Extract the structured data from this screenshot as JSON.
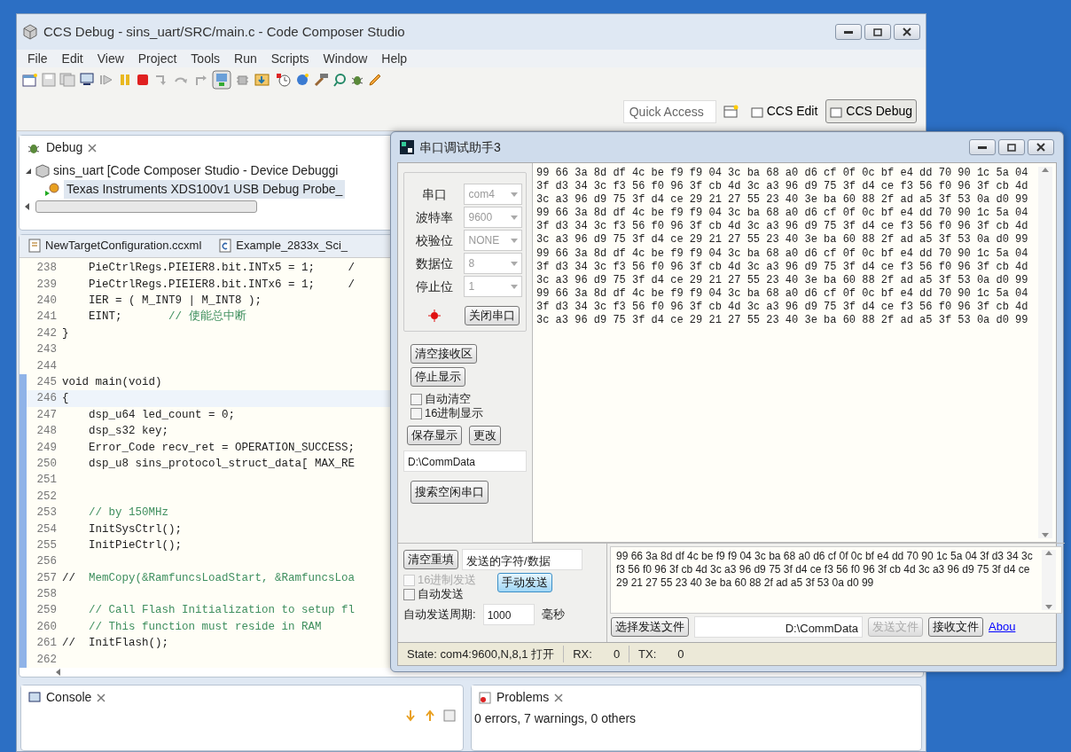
{
  "ccs_window": {
    "title": "CCS Debug - sins_uart/SRC/main.c - Code Composer Studio"
  },
  "menu": [
    "File",
    "Edit",
    "View",
    "Project",
    "Tools",
    "Run",
    "Scripts",
    "Window",
    "Help"
  ],
  "quick_access": {
    "placeholder": "Quick Access"
  },
  "perspectives": [
    {
      "label": "CCS Edit",
      "selected": false
    },
    {
      "label": "CCS Debug",
      "selected": true
    }
  ],
  "debug_view": {
    "tab": "Debug",
    "tree": [
      {
        "label": "sins_uart [Code Composer Studio - Device Debuggi",
        "expanded": true,
        "selected": false,
        "children": [
          {
            "label": "Texas Instruments XDS100v1 USB Debug Probe_",
            "selected": true
          }
        ]
      }
    ]
  },
  "editor": {
    "tabs": [
      {
        "label": "NewTargetConfiguration.ccxml",
        "kind": "xml"
      },
      {
        "label": "Example_2833x_Sci_",
        "kind": "c"
      }
    ],
    "lines": [
      {
        "number": "238",
        "code": "    PieCtrlRegs.PIEIER8.bit.INTx5 = 1;     /",
        "changed": false,
        "current": false
      },
      {
        "number": "239",
        "code": "    PieCtrlRegs.PIEIER8.bit.INTx6 = 1;     /",
        "changed": false,
        "current": false
      },
      {
        "number": "240",
        "code": "    IER = ( M_INT9 | M_INT8 );",
        "changed": false,
        "current": false
      },
      {
        "number": "241",
        "code": "    EINT;       ",
        "comment": "// 使能总中断",
        "changed": false,
        "current": false
      },
      {
        "number": "242",
        "code": "}",
        "changed": false,
        "current": false
      },
      {
        "number": "243",
        "changed": false,
        "current": false
      },
      {
        "number": "244",
        "changed": false,
        "current": false
      },
      {
        "number": "245",
        "code": "void main(void)",
        "changed": true,
        "current": false
      },
      {
        "number": "246",
        "code": "{",
        "changed": true,
        "current": true
      },
      {
        "number": "247",
        "code": "    dsp_u64 led_count = 0;",
        "changed": true,
        "current": false
      },
      {
        "number": "248",
        "code": "    dsp_s32 key;",
        "changed": true,
        "current": false
      },
      {
        "number": "249",
        "code": "    Error_Code recv_ret = OPERATION_SUCCESS;",
        "changed": true,
        "current": false
      },
      {
        "number": "250",
        "code": "    dsp_u8 sins_protocol_struct_data[ MAX_RE",
        "changed": true,
        "current": false
      },
      {
        "number": "251",
        "changed": true,
        "current": false
      },
      {
        "number": "252",
        "changed": true,
        "current": false
      },
      {
        "number": "253",
        "comment": "    // by 150MHz",
        "changed": true,
        "current": false
      },
      {
        "number": "254",
        "code": "    InitSysCtrl();",
        "changed": true,
        "current": false
      },
      {
        "number": "255",
        "code": "    InitPieCtrl();",
        "changed": true,
        "current": false
      },
      {
        "number": "256",
        "changed": true,
        "current": false
      },
      {
        "number": "257",
        "code": "//  ",
        "comment": "MemCopy(&RamfuncsLoadStart, &RamfuncsLoa",
        "changed": true,
        "current": false
      },
      {
        "number": "258",
        "changed": true,
        "current": false
      },
      {
        "number": "259",
        "comment": "    // Call Flash Initialization to setup fl",
        "changed": true,
        "current": false
      },
      {
        "number": "260",
        "comment": "    // This function must reside in RAM",
        "changed": true,
        "current": false
      },
      {
        "number": "261",
        "code": "//  InitFlash();",
        "changed": true,
        "current": false
      },
      {
        "number": "262",
        "changed": true,
        "current": false
      }
    ]
  },
  "console_view": {
    "tab": "Console"
  },
  "problems_view": {
    "tab": "Problems",
    "summary": "0 errors, 7 warnings, 0 others"
  },
  "serial_window": {
    "title": "串口调试助手3",
    "settings": [
      {
        "label": "串口",
        "value": "com4"
      },
      {
        "label": "波特率",
        "value": "9600"
      },
      {
        "label": "校验位",
        "value": "NONE"
      },
      {
        "label": "数据位",
        "value": "8"
      },
      {
        "label": "停止位",
        "value": "1"
      }
    ],
    "port_open": true,
    "close_port_button": "关闭串口",
    "receive_buttons": [
      "清空接收区",
      "停止显示"
    ],
    "receive_options": [
      {
        "label": "自动清空",
        "checked": false,
        "disabled": false
      },
      {
        "label": "16进制显示",
        "checked": false,
        "disabled": false
      }
    ],
    "save_buttons": [
      "保存显示",
      "更改"
    ],
    "save_path": "D:\\CommData",
    "search_button": "搜索空闲串口",
    "received": [
      "99 66 3a 8d df 4c be f9 f9 04 3c ba 68 a0 d6 cf 0f 0c bf e4 dd 70 90 1c 5a 04",
      "3f d3 34 3c f3 56 f0 96 3f cb 4d 3c a3 96 d9 75 3f d4 ce f3 56 f0 96 3f cb 4d",
      "3c a3 96 d9 75 3f d4 ce 29 21 27 55 23 40 3e ba 60 88 2f ad a5 3f 53 0a d0 99",
      "99 66 3a 8d df 4c be f9 f9 04 3c ba 68 a0 d6 cf 0f 0c bf e4 dd 70 90 1c 5a 04",
      "3f d3 34 3c f3 56 f0 96 3f cb 4d 3c a3 96 d9 75 3f d4 ce f3 56 f0 96 3f cb 4d",
      "3c a3 96 d9 75 3f d4 ce 29 21 27 55 23 40 3e ba 60 88 2f ad a5 3f 53 0a d0 99",
      "99 66 3a 8d df 4c be f9 f9 04 3c ba 68 a0 d6 cf 0f 0c bf e4 dd 70 90 1c 5a 04",
      "3f d3 34 3c f3 56 f0 96 3f cb 4d 3c a3 96 d9 75 3f d4 ce f3 56 f0 96 3f cb 4d",
      "3c a3 96 d9 75 3f d4 ce 29 21 27 55 23 40 3e ba 60 88 2f ad a5 3f 53 0a d0 99",
      "99 66 3a 8d df 4c be f9 f9 04 3c ba 68 a0 d6 cf 0f 0c bf e4 dd 70 90 1c 5a 04",
      "3f d3 34 3c f3 56 f0 96 3f cb 4d 3c a3 96 d9 75 3f d4 ce f3 56 f0 96 3f cb 4d",
      "3c a3 96 d9 75 3f d4 ce 29 21 27 55 23 40 3e ba 60 88 2f ad a5 3f 53 0a d0 99"
    ],
    "clear_refill_button": "清空重填",
    "send_mode": "发送的字符/数据",
    "send_options": [
      {
        "label": "16进制发送",
        "checked": false,
        "disabled": true
      },
      {
        "label": "自动发送",
        "checked": false,
        "disabled": false
      }
    ],
    "manual_send_button": {
      "label": "手动发送",
      "focused": true
    },
    "period_label": "自动发送周期:",
    "period_value": "1000",
    "period_unit": "毫秒",
    "send_text": "99 66 3a 8d df 4c be f9 f9 04 3c ba 68 a0 d6 cf 0f 0c bf e4 dd 70 90 1c 5a 04 3f d3 34 3c f3 56 f0 96 3f cb 4d 3c a3 96 d9 75 3f d4 ce f3 56 f0 96 3f cb 4d 3c a3 96 d9 75 3f d4 ce 29 21 27 55 23 40 3e ba 60 88 2f ad a5 3f 53 0a d0 99",
    "file_buttons": [
      {
        "label": "选择发送文件",
        "disabled": false
      }
    ],
    "file_path": "D:\\CommData",
    "file_actions": [
      {
        "label": "发送文件",
        "disabled": true
      },
      {
        "label": "接收文件",
        "disabled": false
      }
    ],
    "about_link": "Abou",
    "status": {
      "state": "State: com4:9600,N,8,1 打开",
      "rx_label": "RX:",
      "rx": "0",
      "tx_label": "TX:",
      "tx": "0"
    }
  }
}
